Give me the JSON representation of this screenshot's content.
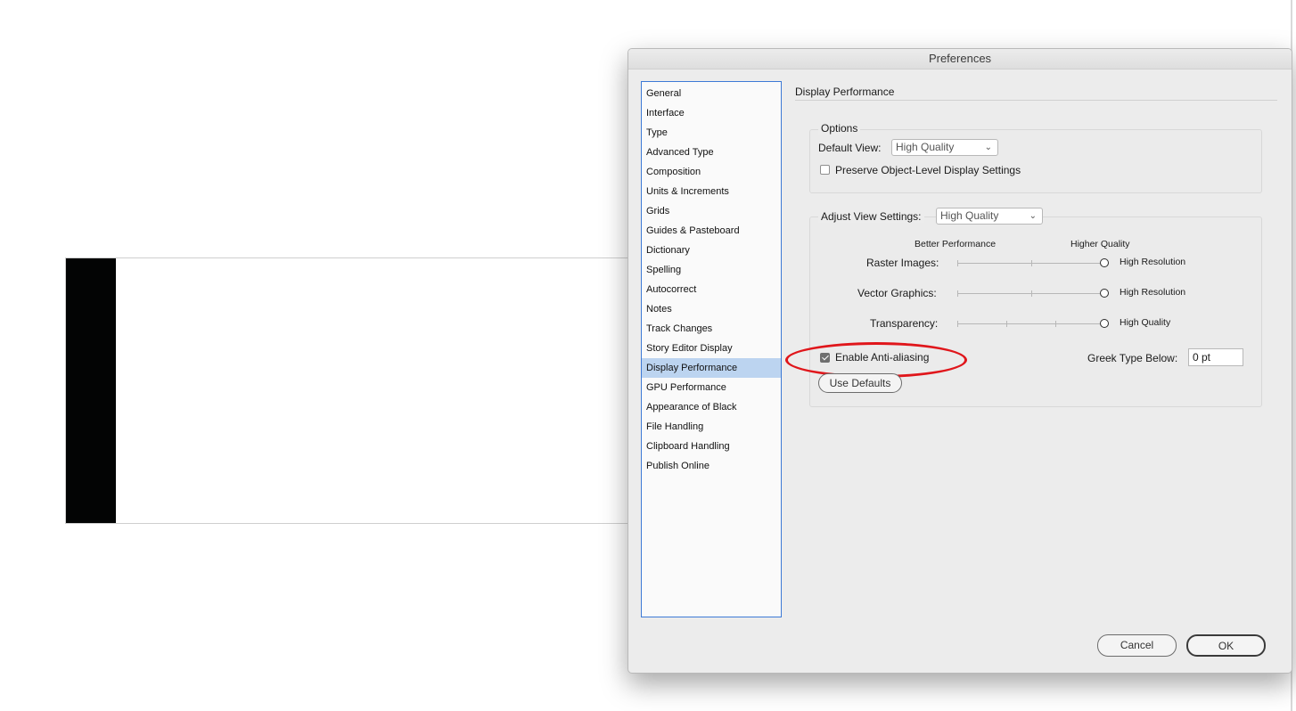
{
  "dialog": {
    "title": "Preferences"
  },
  "sidebar": {
    "items": [
      {
        "label": "General"
      },
      {
        "label": "Interface"
      },
      {
        "label": "Type"
      },
      {
        "label": "Advanced Type"
      },
      {
        "label": "Composition"
      },
      {
        "label": "Units & Increments"
      },
      {
        "label": "Grids"
      },
      {
        "label": "Guides & Pasteboard"
      },
      {
        "label": "Dictionary"
      },
      {
        "label": "Spelling"
      },
      {
        "label": "Autocorrect"
      },
      {
        "label": "Notes"
      },
      {
        "label": "Track Changes"
      },
      {
        "label": "Story Editor Display"
      },
      {
        "label": "Display Performance",
        "selected": true
      },
      {
        "label": "GPU Performance"
      },
      {
        "label": "Appearance of Black"
      },
      {
        "label": "File Handling"
      },
      {
        "label": "Clipboard Handling"
      },
      {
        "label": "Publish Online"
      }
    ]
  },
  "panel": {
    "title": "Display Performance",
    "options": {
      "group_label": "Options",
      "default_view_label": "Default View:",
      "default_view_value": "High Quality",
      "preserve_label": "Preserve Object-Level Display Settings",
      "preserve_checked": false
    },
    "adjust": {
      "label": "Adjust View Settings:",
      "value": "High Quality",
      "better_performance": "Better Performance",
      "higher_quality": "Higher Quality",
      "sliders": [
        {
          "label": "Raster Images:",
          "value_label": "High Resolution"
        },
        {
          "label": "Vector Graphics:",
          "value_label": "High Resolution"
        },
        {
          "label": "Transparency:",
          "value_label": "High Quality"
        }
      ],
      "antialias_label": "Enable Anti-aliasing",
      "antialias_checked": true,
      "greek_label": "Greek Type Below:",
      "greek_value": "0 pt",
      "use_defaults": "Use Defaults"
    }
  },
  "buttons": {
    "cancel": "Cancel",
    "ok": "OK"
  },
  "icons": {
    "dropdown": "chevron-down-icon",
    "checkbox_check": "checkmark-icon"
  },
  "colors": {
    "selection": "#bcd4f0",
    "focus_border": "#3d7ad6",
    "annotation": "#e0161b"
  }
}
